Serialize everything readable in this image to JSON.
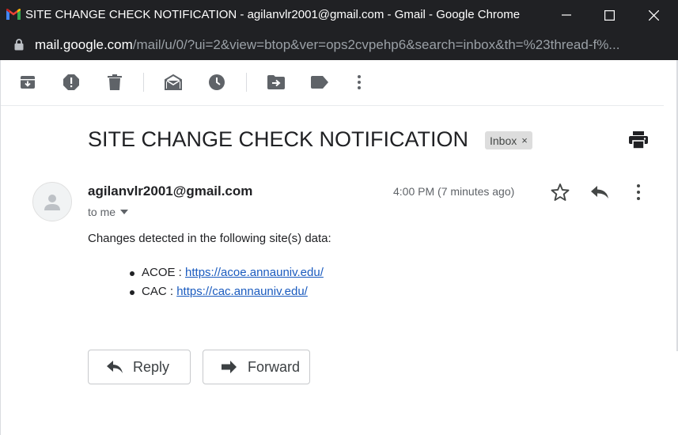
{
  "window": {
    "title": "SITE CHANGE CHECK NOTIFICATION - agilanvlr2001@gmail.com - Gmail - Google Chrome",
    "controls": [
      "minimize-icon",
      "maximize-icon",
      "close-icon"
    ]
  },
  "address_bar": {
    "host": "mail.google.com",
    "path": "/mail/u/0/?ui=2&view=btop&ver=ops2cvpehp6&search=inbox&th=%23thread-f%..."
  },
  "toolbar": {
    "icons": [
      "archive-icon",
      "report-spam-icon",
      "delete-icon",
      "mark-unread-icon",
      "snooze-icon",
      "move-to-icon",
      "label-icon",
      "more-vert-icon"
    ]
  },
  "email": {
    "subject": "SITE CHANGE CHECK NOTIFICATION",
    "label_chip": "Inbox",
    "label_chip_close": "×",
    "sender": "agilanvlr2001@gmail.com",
    "recipient": "to me",
    "timestamp": "4:00 PM (7 minutes ago)",
    "body_intro": "Changes detected in the following site(s) data:",
    "sites": [
      {
        "name": "ACOE : ",
        "url": "https://acoe.annauniv.edu/"
      },
      {
        "name": "CAC : ",
        "url": "https://cac.annauniv.edu/"
      }
    ]
  },
  "actions": {
    "reply_label": "Reply",
    "forward_label": "Forward"
  },
  "colors": {
    "chrome_bg": "#202124",
    "link": "#1a5bbf",
    "chip_bg": "#dddddd",
    "icon": "#5f6368"
  }
}
